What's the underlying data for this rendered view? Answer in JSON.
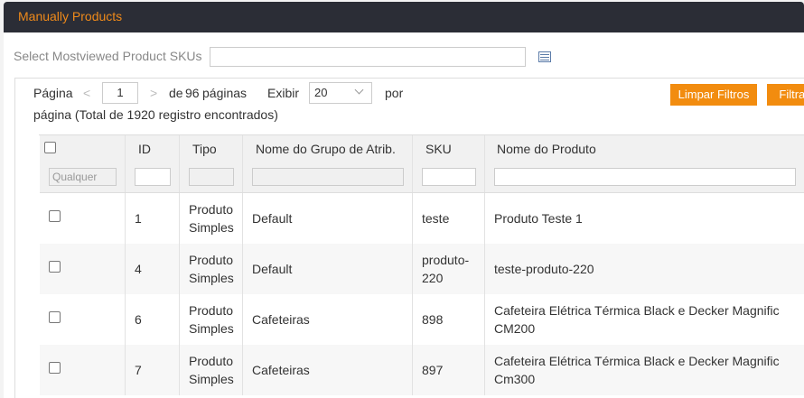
{
  "panel": {
    "title": "Manually Products"
  },
  "sku_selector": {
    "label": "Select Mostviewed Product SKUs",
    "value": "",
    "icon": "grid-list-icon"
  },
  "pager": {
    "page_label": "Página",
    "current_page": "1",
    "of_label": "de",
    "total_pages": "96",
    "pages_label": "páginas",
    "show_label": "Exibir",
    "per_page": "20",
    "per_label": "por",
    "total_line_prefix": "página (Total de",
    "total_records": "1920",
    "total_line_suffix": "registro encontrados)"
  },
  "buttons": {
    "clear": "Limpar Filtros",
    "filter": "Filtrar"
  },
  "table": {
    "columns": [
      "ID",
      "Tipo",
      "Nome do Grupo de Atrib.",
      "SKU",
      "Nome do Produto"
    ],
    "filter_any": "Qualquer",
    "rows": [
      {
        "id": "1",
        "tipo_1": "Produto",
        "tipo_2": "Simples",
        "grupo": "Default",
        "sku_1": "teste",
        "sku_2": "",
        "nome_1": "Produto Teste 1",
        "nome_2": ""
      },
      {
        "id": "4",
        "tipo_1": "Produto",
        "tipo_2": "Simples",
        "grupo": "Default",
        "sku_1": "produto-",
        "sku_2": "220",
        "nome_1": "teste-produto-220",
        "nome_2": ""
      },
      {
        "id": "6",
        "tipo_1": "Produto",
        "tipo_2": "Simples",
        "grupo": "Cafeteiras",
        "sku_1": "898",
        "sku_2": "",
        "nome_1": "Cafeteira Elétrica Térmica Black e Decker Magnific",
        "nome_2": "CM200"
      },
      {
        "id": "7",
        "tipo_1": "Produto",
        "tipo_2": "Simples",
        "grupo": "Cafeteiras",
        "sku_1": "897",
        "sku_2": "",
        "nome_1": "Cafeteira Elétrica Térmica Black e Decker Magnific",
        "nome_2": "Cm300"
      }
    ]
  },
  "colors": {
    "accent": "#f28c0f",
    "header_bg": "#2b2d36",
    "title": "#ef8a1a"
  }
}
